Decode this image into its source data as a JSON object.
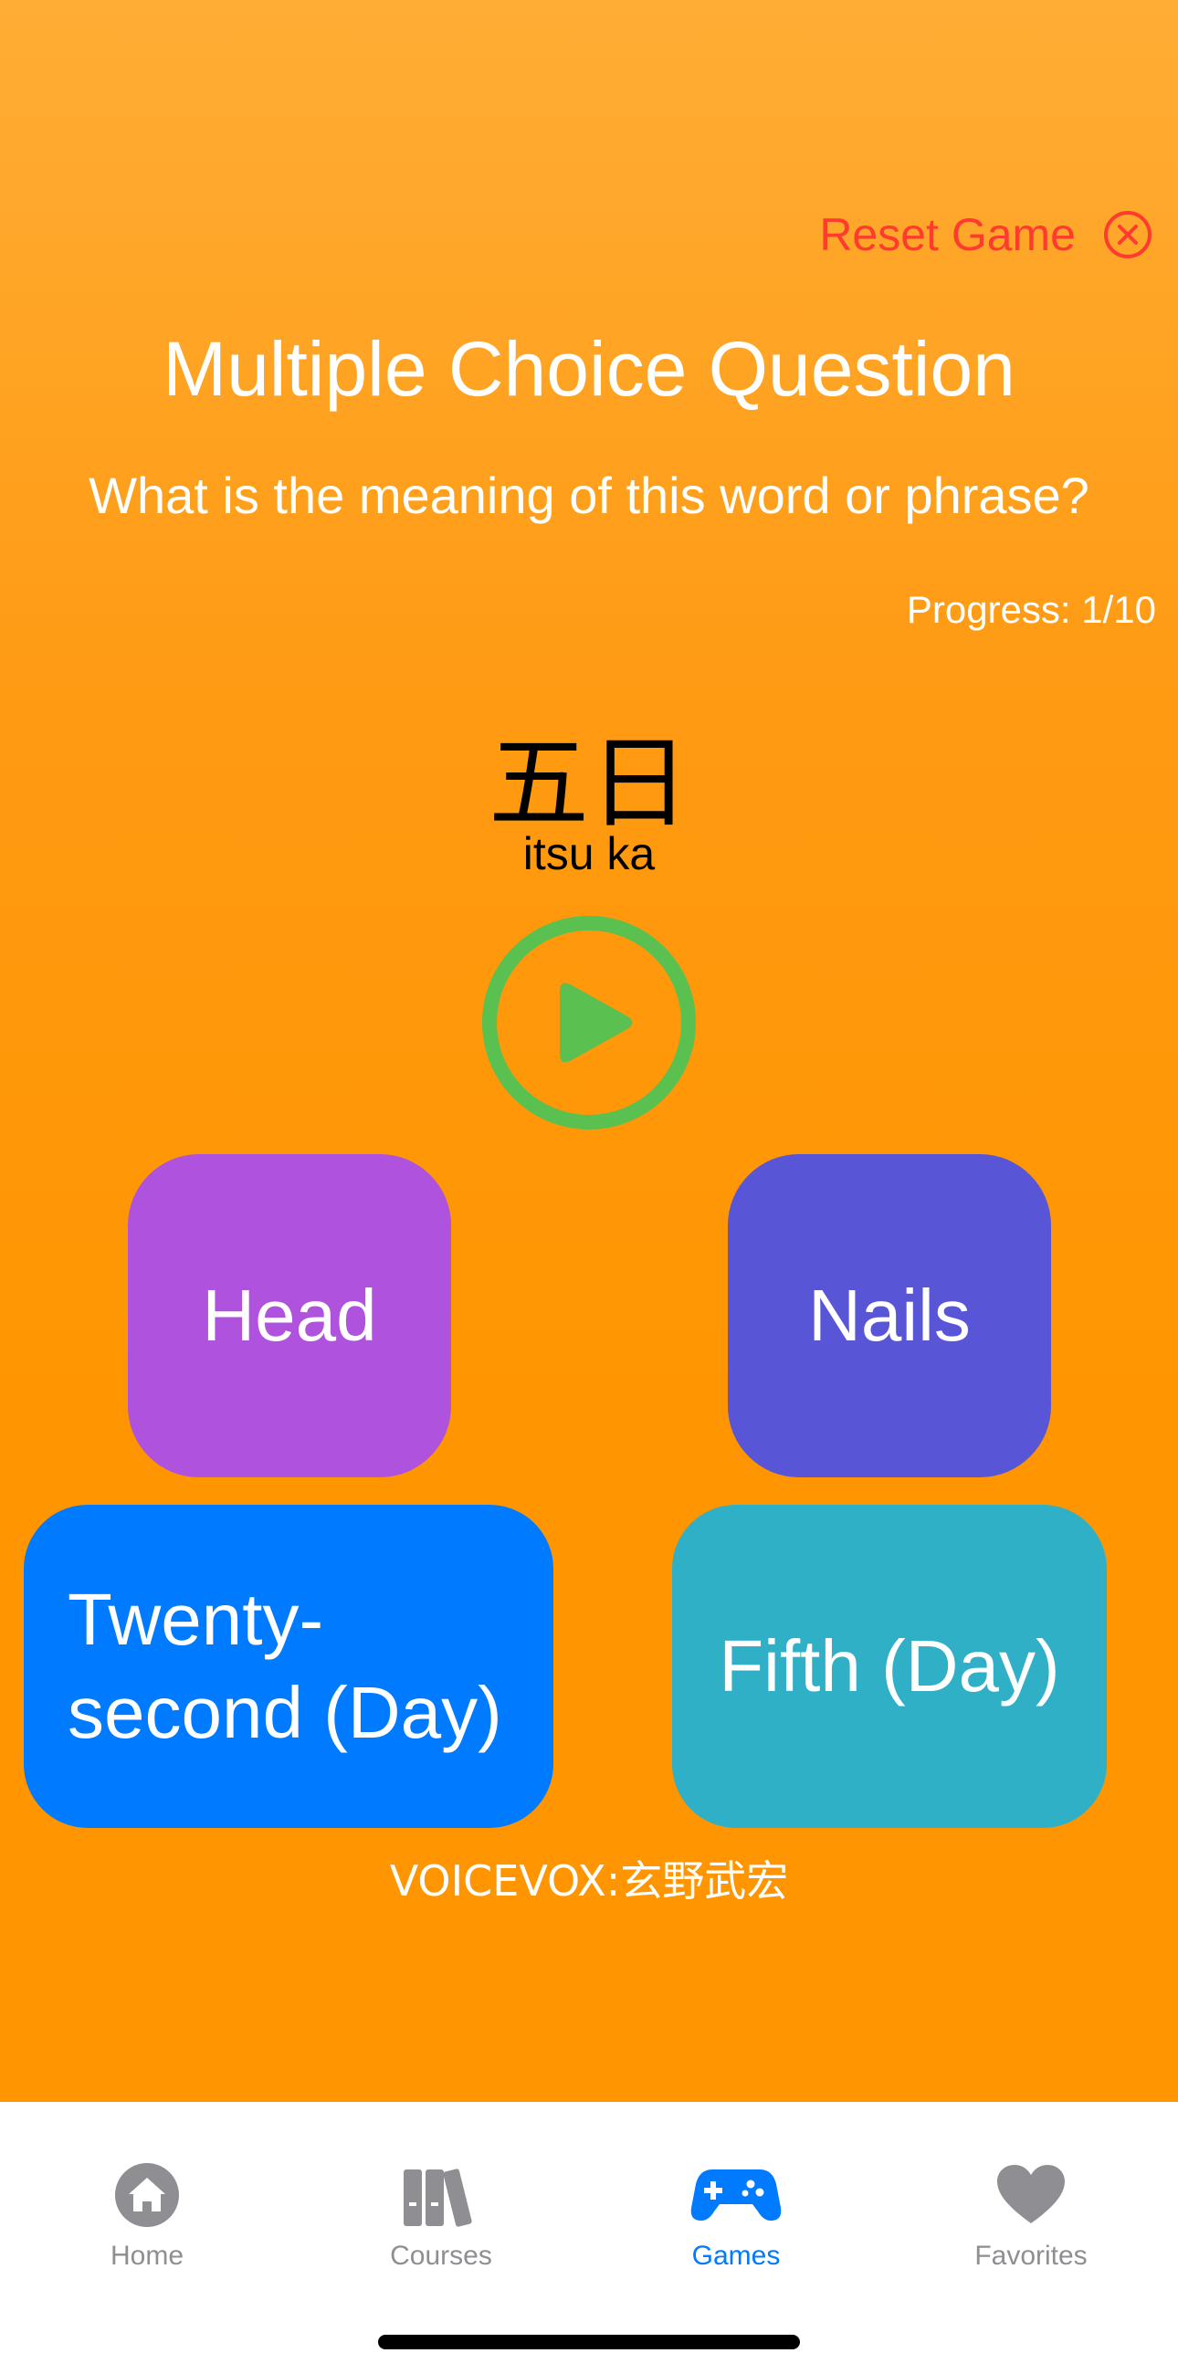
{
  "header": {
    "reset_label": "Reset Game",
    "reset_icon": "close-circle-icon"
  },
  "question": {
    "title": "Multiple Choice Question",
    "prompt": "What is the meaning of this word or phrase?",
    "progress": "Progress: 1/10",
    "word": "五日",
    "reading": "itsu ka"
  },
  "audio": {
    "icon": "play-icon",
    "ring_color": "#5ac04f"
  },
  "options": [
    {
      "label": "Head",
      "color": "#af52de"
    },
    {
      "label": "Nails",
      "color": "#5856d6"
    },
    {
      "label": "Twenty-second (Day)",
      "line1": "Twenty-",
      "line2": "second (Day)",
      "color": "#007aff"
    },
    {
      "label": "Fifth (Day)",
      "color": "#30b0c7"
    }
  ],
  "credit": "VOICEVOX:玄野武宏",
  "tabbar": {
    "items": [
      {
        "label": "Home",
        "icon": "home-icon",
        "active": false
      },
      {
        "label": "Courses",
        "icon": "books-icon",
        "active": false
      },
      {
        "label": "Games",
        "icon": "gamecontroller-icon",
        "active": true
      },
      {
        "label": "Favorites",
        "icon": "heart-icon",
        "active": false
      }
    ]
  },
  "colors": {
    "background": "#ff9500",
    "reset": "#ff3b30",
    "tab_active": "#007aff",
    "tab_inactive": "#8e8e93"
  }
}
